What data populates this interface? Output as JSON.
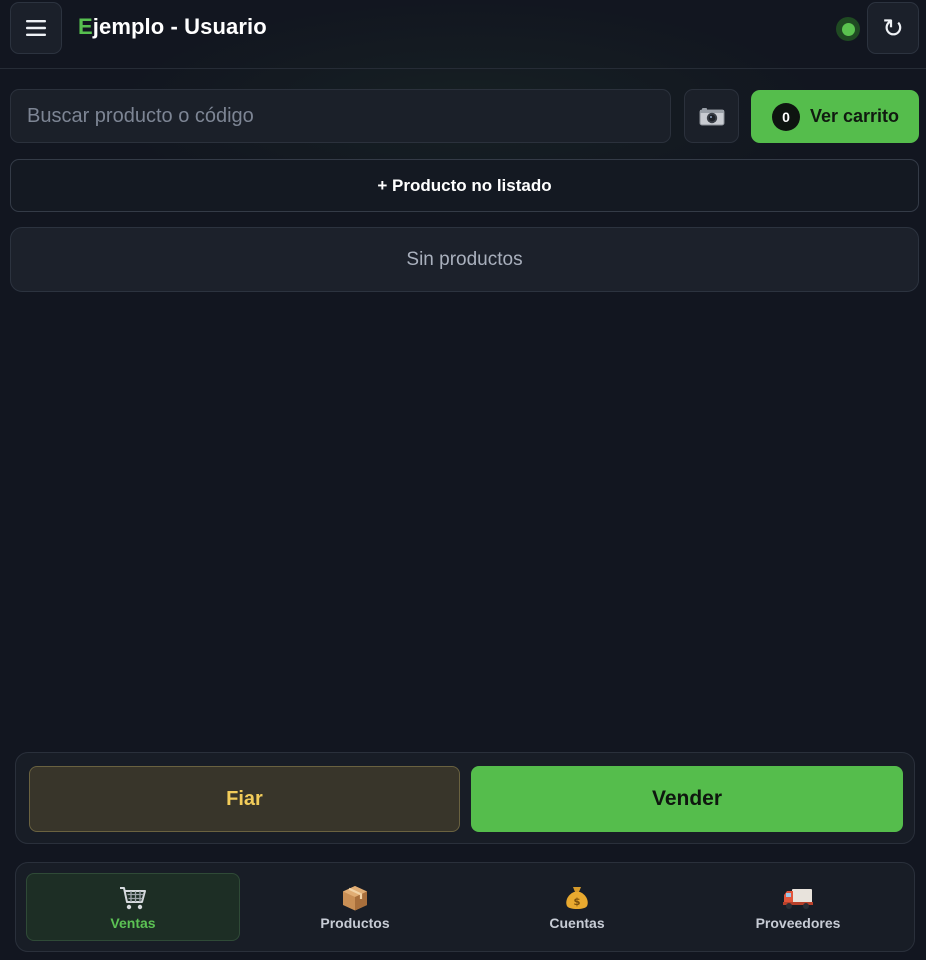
{
  "header": {
    "title_first": "E",
    "title_rest": "jemplo - Usuario",
    "menu_icon": "hamburger-menu-icon",
    "refresh_icon": "refresh-icon",
    "refresh_glyph": "↻",
    "status": "online"
  },
  "search": {
    "placeholder": "Buscar producto o código",
    "value": ""
  },
  "camera": {
    "icon": "camera-icon"
  },
  "cart": {
    "count": "0",
    "label": "Ver carrito"
  },
  "add_product": {
    "label": "+ Producto no listado"
  },
  "products": {
    "empty_text": "Sin productos",
    "items": []
  },
  "actions": {
    "fiar_label": "Fiar",
    "vender_label": "Vender"
  },
  "nav": {
    "items": [
      {
        "label": "Ventas",
        "icon": "shopping-cart-icon",
        "active": true
      },
      {
        "label": "Productos",
        "icon": "package-icon",
        "active": false
      },
      {
        "label": "Cuentas",
        "icon": "money-bag-icon",
        "active": false
      },
      {
        "label": "Proveedores",
        "icon": "delivery-truck-icon",
        "active": false
      }
    ]
  },
  "colors": {
    "background": "#121620",
    "accent_green": "#55bd4c",
    "fiar_yellow": "#f2cc5a",
    "panel": "#1b2029"
  }
}
